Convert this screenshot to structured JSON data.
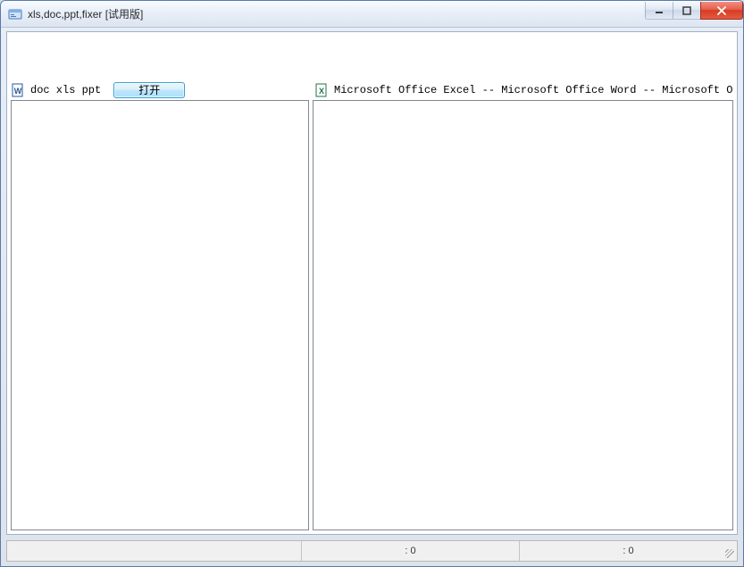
{
  "window": {
    "title": "xls,doc,ppt,fixer [试用版]"
  },
  "left_panel": {
    "icon": "word-doc-icon",
    "label": "doc xls ppt",
    "open_button": "打开"
  },
  "right_panel": {
    "icon": "excel-doc-icon",
    "label": "Microsoft Office Excel -- Microsoft Office Word -- Microsoft Office PowerPoint"
  },
  "statusbar": {
    "cell1": "",
    "cell2": ": 0",
    "cell3": ": 0"
  }
}
